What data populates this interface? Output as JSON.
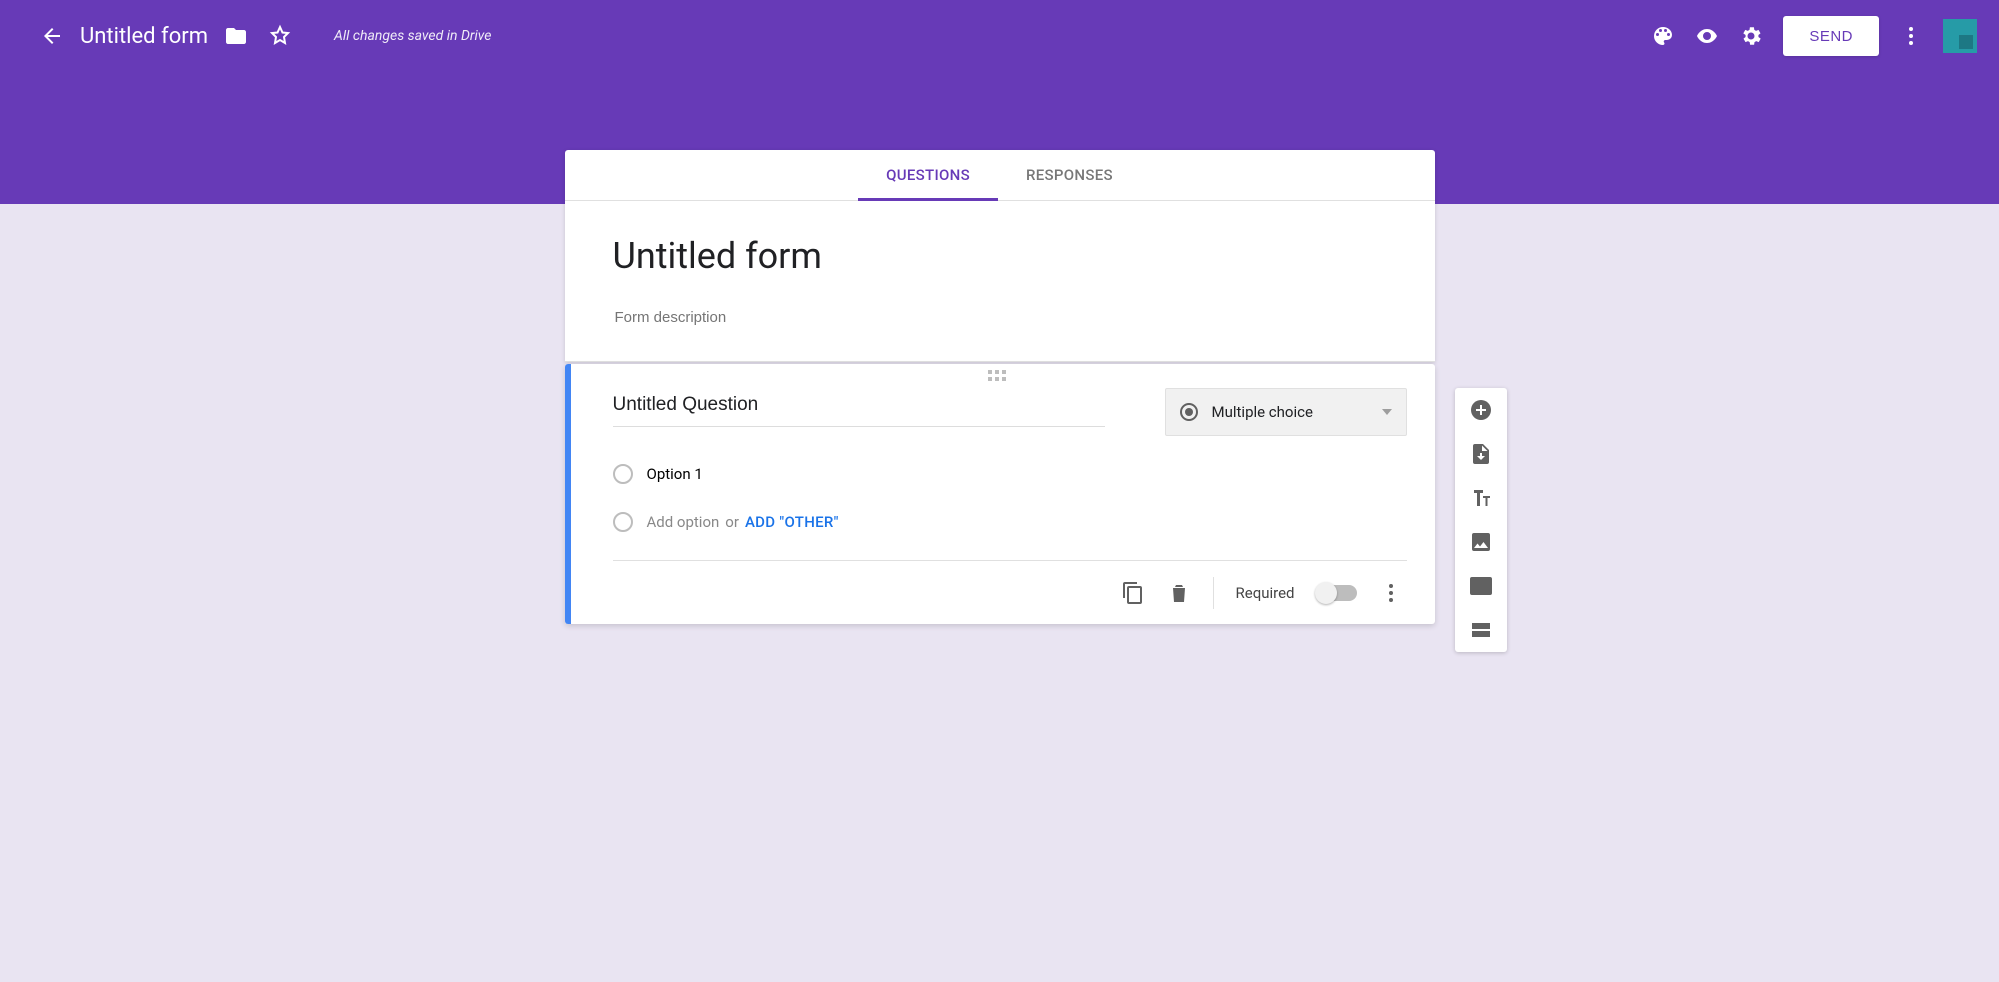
{
  "header": {
    "title": "Untitled form",
    "save_status": "All changes saved in Drive",
    "send_label": "SEND"
  },
  "tabs": {
    "questions": "QUESTIONS",
    "responses": "RESPONSES",
    "active": "questions"
  },
  "form": {
    "title": "Untitled form",
    "description_placeholder": "Form description"
  },
  "question": {
    "title": "Untitled Question",
    "type_label": "Multiple choice",
    "options": [
      "Option 1"
    ],
    "add_option_text": "Add option",
    "or_text": "or",
    "add_other_label": "ADD \"OTHER\"",
    "required_label": "Required",
    "required": false
  }
}
